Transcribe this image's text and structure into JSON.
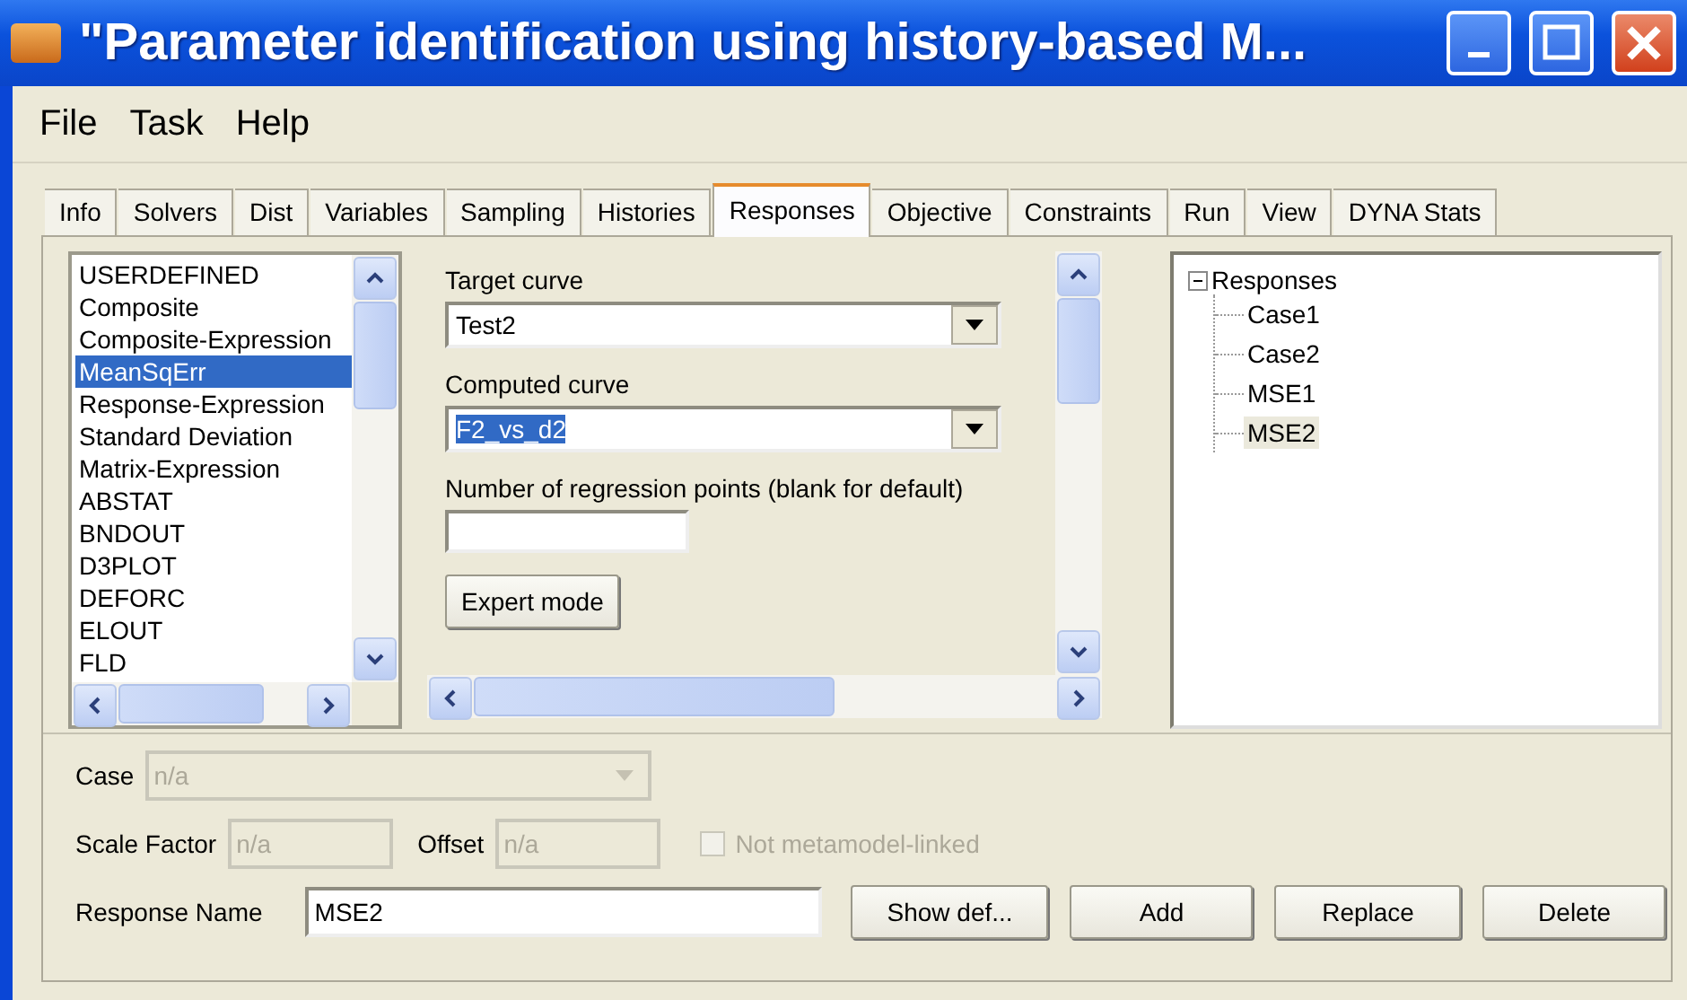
{
  "window": {
    "title": "\"Parameter identification using history-based M..."
  },
  "menu": [
    "File",
    "Task",
    "Help"
  ],
  "tabs": [
    {
      "label": "Info",
      "selected": false
    },
    {
      "label": "Solvers",
      "selected": false
    },
    {
      "label": "Dist",
      "selected": false
    },
    {
      "label": "Variables",
      "selected": false
    },
    {
      "label": "Sampling",
      "selected": false
    },
    {
      "label": "Histories",
      "selected": false
    },
    {
      "label": "Responses",
      "selected": true
    },
    {
      "label": "Objective",
      "selected": false
    },
    {
      "label": "Constraints",
      "selected": false
    },
    {
      "label": "Run",
      "selected": false
    },
    {
      "label": "View",
      "selected": false
    },
    {
      "label": "DYNA Stats",
      "selected": false
    }
  ],
  "response_types": [
    {
      "label": "USERDEFINED",
      "selected": false
    },
    {
      "label": "Composite",
      "selected": false
    },
    {
      "label": "Composite-Expression",
      "selected": false
    },
    {
      "label": "MeanSqErr",
      "selected": true
    },
    {
      "label": "Response-Expression",
      "selected": false
    },
    {
      "label": "Standard Deviation",
      "selected": false
    },
    {
      "label": "Matrix-Expression",
      "selected": false
    },
    {
      "label": "ABSTAT",
      "selected": false
    },
    {
      "label": "BNDOUT",
      "selected": false
    },
    {
      "label": "D3PLOT",
      "selected": false
    },
    {
      "label": "DEFORC",
      "selected": false
    },
    {
      "label": "ELOUT",
      "selected": false
    },
    {
      "label": "FLD",
      "selected": false
    }
  ],
  "target_curve": {
    "label": "Target curve",
    "value": "Test2",
    "text_selected": false
  },
  "computed_curve": {
    "label": "Computed curve",
    "value": "F2_vs_d2",
    "text_selected": true
  },
  "regression_points": {
    "label": "Number of regression points (blank for default)"
  },
  "expert_button": "Expert mode",
  "tree": {
    "label": "Responses",
    "expanded": true,
    "children": [
      {
        "label": "Case1",
        "selected": false
      },
      {
        "label": "Case2",
        "selected": false
      },
      {
        "label": "MSE1",
        "selected": false
      },
      {
        "label": "MSE2",
        "selected": true
      }
    ]
  },
  "case": {
    "label": "Case",
    "value": "n/a",
    "disabled": true
  },
  "scale_factor": {
    "label": "Scale Factor",
    "value": "n/a",
    "disabled": true
  },
  "offset": {
    "label": "Offset",
    "value": "n/a",
    "disabled": true
  },
  "not_linked": {
    "label": "Not metamodel-linked",
    "checked": false,
    "disabled": true
  },
  "response_name": {
    "label": "Response Name",
    "value": "MSE2"
  },
  "buttons": [
    "Show def...",
    "Add",
    "Replace",
    "Delete"
  ]
}
